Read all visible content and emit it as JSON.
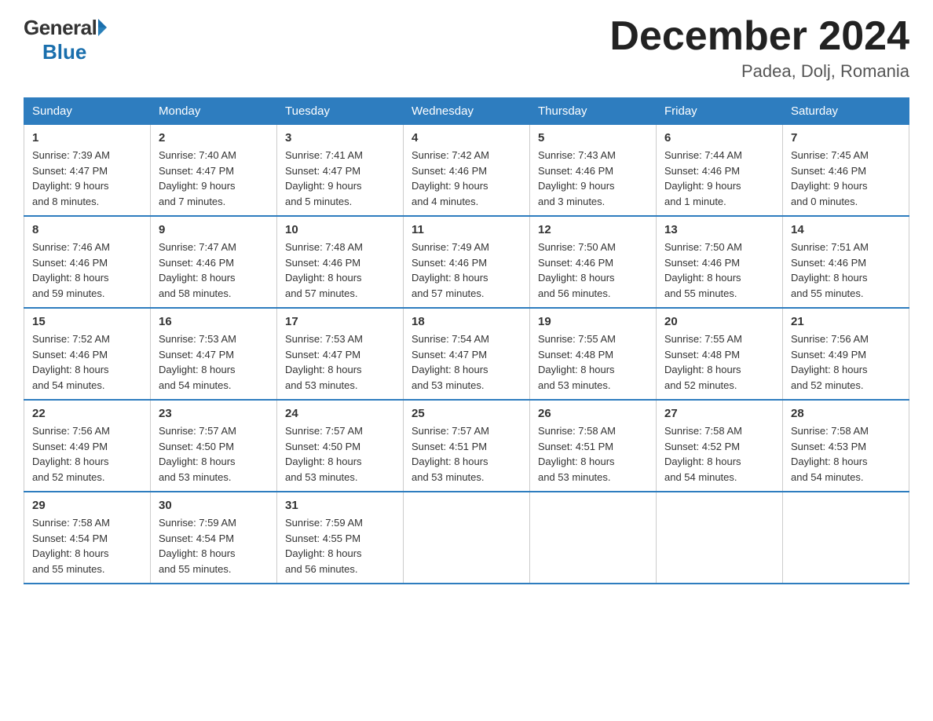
{
  "header": {
    "logo": {
      "general": "General",
      "blue": "Blue"
    },
    "title": "December 2024",
    "location": "Padea, Dolj, Romania"
  },
  "days_of_week": [
    "Sunday",
    "Monday",
    "Tuesday",
    "Wednesday",
    "Thursday",
    "Friday",
    "Saturday"
  ],
  "weeks": [
    [
      {
        "day": "1",
        "sunrise": "7:39 AM",
        "sunset": "4:47 PM",
        "daylight": "9 hours and 8 minutes."
      },
      {
        "day": "2",
        "sunrise": "7:40 AM",
        "sunset": "4:47 PM",
        "daylight": "9 hours and 7 minutes."
      },
      {
        "day": "3",
        "sunrise": "7:41 AM",
        "sunset": "4:47 PM",
        "daylight": "9 hours and 5 minutes."
      },
      {
        "day": "4",
        "sunrise": "7:42 AM",
        "sunset": "4:46 PM",
        "daylight": "9 hours and 4 minutes."
      },
      {
        "day": "5",
        "sunrise": "7:43 AM",
        "sunset": "4:46 PM",
        "daylight": "9 hours and 3 minutes."
      },
      {
        "day": "6",
        "sunrise": "7:44 AM",
        "sunset": "4:46 PM",
        "daylight": "9 hours and 1 minute."
      },
      {
        "day": "7",
        "sunrise": "7:45 AM",
        "sunset": "4:46 PM",
        "daylight": "9 hours and 0 minutes."
      }
    ],
    [
      {
        "day": "8",
        "sunrise": "7:46 AM",
        "sunset": "4:46 PM",
        "daylight": "8 hours and 59 minutes."
      },
      {
        "day": "9",
        "sunrise": "7:47 AM",
        "sunset": "4:46 PM",
        "daylight": "8 hours and 58 minutes."
      },
      {
        "day": "10",
        "sunrise": "7:48 AM",
        "sunset": "4:46 PM",
        "daylight": "8 hours and 57 minutes."
      },
      {
        "day": "11",
        "sunrise": "7:49 AM",
        "sunset": "4:46 PM",
        "daylight": "8 hours and 57 minutes."
      },
      {
        "day": "12",
        "sunrise": "7:50 AM",
        "sunset": "4:46 PM",
        "daylight": "8 hours and 56 minutes."
      },
      {
        "day": "13",
        "sunrise": "7:50 AM",
        "sunset": "4:46 PM",
        "daylight": "8 hours and 55 minutes."
      },
      {
        "day": "14",
        "sunrise": "7:51 AM",
        "sunset": "4:46 PM",
        "daylight": "8 hours and 55 minutes."
      }
    ],
    [
      {
        "day": "15",
        "sunrise": "7:52 AM",
        "sunset": "4:46 PM",
        "daylight": "8 hours and 54 minutes."
      },
      {
        "day": "16",
        "sunrise": "7:53 AM",
        "sunset": "4:47 PM",
        "daylight": "8 hours and 54 minutes."
      },
      {
        "day": "17",
        "sunrise": "7:53 AM",
        "sunset": "4:47 PM",
        "daylight": "8 hours and 53 minutes."
      },
      {
        "day": "18",
        "sunrise": "7:54 AM",
        "sunset": "4:47 PM",
        "daylight": "8 hours and 53 minutes."
      },
      {
        "day": "19",
        "sunrise": "7:55 AM",
        "sunset": "4:48 PM",
        "daylight": "8 hours and 53 minutes."
      },
      {
        "day": "20",
        "sunrise": "7:55 AM",
        "sunset": "4:48 PM",
        "daylight": "8 hours and 52 minutes."
      },
      {
        "day": "21",
        "sunrise": "7:56 AM",
        "sunset": "4:49 PM",
        "daylight": "8 hours and 52 minutes."
      }
    ],
    [
      {
        "day": "22",
        "sunrise": "7:56 AM",
        "sunset": "4:49 PM",
        "daylight": "8 hours and 52 minutes."
      },
      {
        "day": "23",
        "sunrise": "7:57 AM",
        "sunset": "4:50 PM",
        "daylight": "8 hours and 53 minutes."
      },
      {
        "day": "24",
        "sunrise": "7:57 AM",
        "sunset": "4:50 PM",
        "daylight": "8 hours and 53 minutes."
      },
      {
        "day": "25",
        "sunrise": "7:57 AM",
        "sunset": "4:51 PM",
        "daylight": "8 hours and 53 minutes."
      },
      {
        "day": "26",
        "sunrise": "7:58 AM",
        "sunset": "4:51 PM",
        "daylight": "8 hours and 53 minutes."
      },
      {
        "day": "27",
        "sunrise": "7:58 AM",
        "sunset": "4:52 PM",
        "daylight": "8 hours and 54 minutes."
      },
      {
        "day": "28",
        "sunrise": "7:58 AM",
        "sunset": "4:53 PM",
        "daylight": "8 hours and 54 minutes."
      }
    ],
    [
      {
        "day": "29",
        "sunrise": "7:58 AM",
        "sunset": "4:54 PM",
        "daylight": "8 hours and 55 minutes."
      },
      {
        "day": "30",
        "sunrise": "7:59 AM",
        "sunset": "4:54 PM",
        "daylight": "8 hours and 55 minutes."
      },
      {
        "day": "31",
        "sunrise": "7:59 AM",
        "sunset": "4:55 PM",
        "daylight": "8 hours and 56 minutes."
      },
      null,
      null,
      null,
      null
    ]
  ],
  "labels": {
    "sunrise": "Sunrise:",
    "sunset": "Sunset:",
    "daylight": "Daylight:"
  }
}
